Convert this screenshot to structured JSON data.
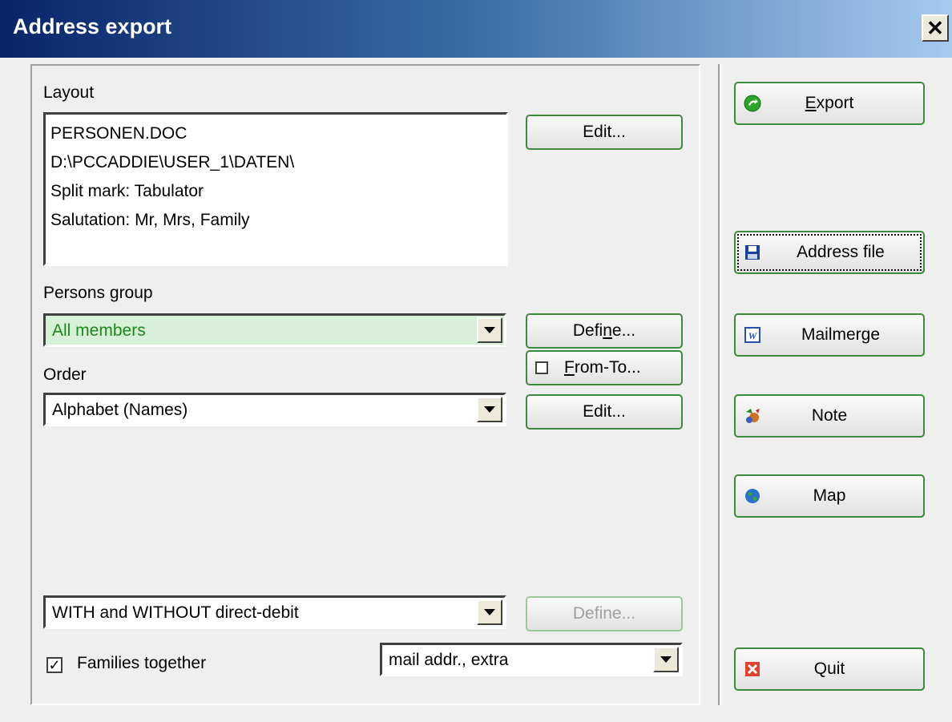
{
  "window": {
    "title": "Address export",
    "close_glyph": "✕"
  },
  "layout": {
    "label": "Layout",
    "lines": [
      "PERSONEN.DOC",
      "D:\\PCCADDIE\\USER_1\\DATEN\\",
      "Split mark: Tabulator",
      "Salutation: Mr, Mrs, Family"
    ],
    "edit_label": "Edit..."
  },
  "persons_group": {
    "label_pre": "Persons ",
    "label_accel": "g",
    "label_post": "roup",
    "selected": "All members",
    "define_pre": "Defi",
    "define_accel": "n",
    "define_post": "e...",
    "selected_color": "#1a8a1a",
    "field_bg": "#d8f0d8"
  },
  "from_to": {
    "accel": "F",
    "rest": "rom-To...",
    "checked": false
  },
  "order": {
    "label": "Order",
    "selected": "Alphabet (Names)",
    "edit_label": "Edit..."
  },
  "direct_debit": {
    "selected": "WITH and WITHOUT direct-debit",
    "define_label": "Define..."
  },
  "families": {
    "label": "Families together",
    "checked": true,
    "check_glyph": "✓",
    "mode_selected": "mail addr., extra"
  },
  "actions": {
    "export": {
      "accel": "E",
      "rest": "xport",
      "icon": "green-arrow-icon"
    },
    "address_file": {
      "label": "Address file",
      "icon": "floppy-disk-icon"
    },
    "mailmerge": {
      "label": "Mailmerge",
      "icon": "word-document-icon"
    },
    "note": {
      "label": "Note",
      "icon": "note-icon"
    },
    "map": {
      "label": "Map",
      "icon": "globe-icon"
    },
    "quit": {
      "label": "Quit",
      "icon": "red-x-icon"
    }
  }
}
